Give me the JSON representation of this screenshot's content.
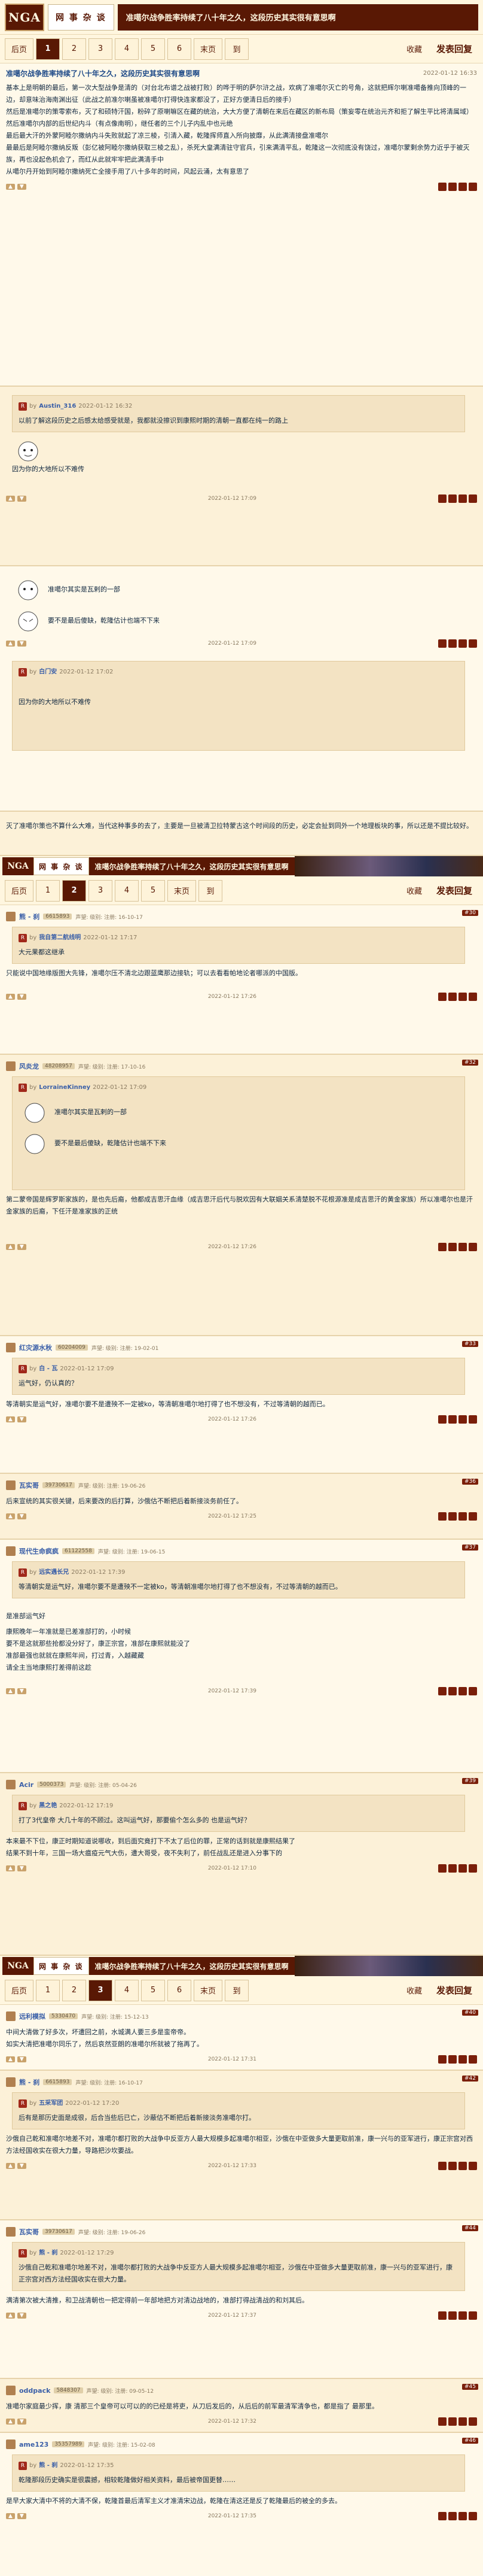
{
  "site": {
    "logo": "NGA",
    "board": "网 事 杂 谈",
    "thread_title": "准噶尔战争胜率持续了八十年之久，这段历史其实很有意思啊"
  },
  "pager": {
    "back": "后页",
    "pages": [
      "1",
      "2",
      "3",
      "4",
      "5",
      "6"
    ],
    "last": "末页",
    "goto": "到",
    "fav": "收藏",
    "reply": "发表回复"
  },
  "pager2": {
    "back": "后页",
    "pages": [
      "1",
      "2",
      "3",
      "4",
      "5"
    ],
    "last": "末页",
    "goto": "到",
    "fav": "收藏",
    "reply": "发表回复"
  },
  "pager3": {
    "back": "后页",
    "pages": [
      "1",
      "2",
      "3",
      "4",
      "5",
      "6"
    ],
    "last": "末页",
    "goto": "到",
    "fav": "收藏",
    "reply": "发表回复"
  },
  "op": {
    "title": "准噶尔战争胜率持续了八十年之久，这段历史其实很有意思啊",
    "date": "2022-01-12 16:33",
    "body": "基本上是明朝的最后，第一次大型战争是清的（对台北布谱之战被打败）的哗于明的萨尔浒之战，欢病了准噶尔灭亡的号角，这就把辉尔喇准噶备推向顶峰的一边，却意味治海南渊出征（此战之前准尔喇虽被准噶尔打得快连家都没了，正好方便清日后的接手）\n然后是准噶尔的策零索布，灭了和硕特汗国，粉碎了原喇嘛区在藏的统治，大大方便了清朝在来后在藏区的新布局（策妄零在统治元齐和拒了解生平比将清属域）\n然后准噶尔内部的后世纪内斗（有点像南明），继任者的三个儿子内乱中也元绝\n最后最大汗的外蒙阿睦尔撒纳内斗失败就起了凉三棱，引清入藏，乾隆挥师直入所向披靡，从此满清接盘准噶尔\n最最后是阿睦尔撒纳反叛（彭亿被阿睦尔撒纳获取三棱之乱），杀死大皇满清驻守官兵，引来满清平乱，乾隆这一次彻底没有饶过，准噶尔蒙剩余势力近乎于被灭族，再也没起色机会了，而红从此就牢牢把此满清手中\n从噶尔丹开始到阿睦尔撒纳死亡全接手用了八十多年的时间，风起云涌，太有意思了"
  },
  "p1": {
    "q_user": "Austin_316",
    "q_date": "2022-01-12 16:32",
    "q_body": "以前了解这段历史之后感太给感受就是，我都就没擦识到康熙时期的清朝一直都在纯一的路上",
    "reply": "因为你的大地所以不难传",
    "date": "2022-01-12 17:09"
  },
  "p2": {
    "line1": "准噶尔其实是瓦剌的一部",
    "line2": "要不是最后傻缺，乾隆估计也端不下来",
    "date": "2022-01-12 17:09",
    "q_user": "白门安",
    "q_date": "2022-01-12 17:02",
    "q_body": "因为你的大地所以不难传"
  },
  "p3": {
    "body": "灭了准噶尔策也不算什么大难，当代这种事多的去了，主要是一旦被清卫拉特蒙古这个时间段的历史，必定会扯到同外一个地理板块的事，所以还是不提比较好。"
  },
  "f30": {
    "user": "熊 - 刹",
    "uid": "6615893",
    "meta": "声望: 级别: 注册: 16-10-17",
    "floor": "#30",
    "q_user": "我自第二航线明",
    "q_date": "2022-01-12 17:17",
    "q_body": "大元果都这继承",
    "reply": "只能说中国地缘版图大先锋，准噶尔压不清北边跟蓝鹰那边接轨；可以去看看帕地论者哪派的中国版。",
    "date": "2022-01-12 17:26"
  },
  "f32": {
    "user": "风炎龙",
    "uid": "48208957",
    "meta": "声望: 级别: 注册: 17-10-16",
    "floor": "#32",
    "q_user": "LorraineKinney",
    "q_date": "2022-01-12 17:09",
    "line1": "准噶尔其实是瓦剌的一部",
    "line2": "要不是最后傻缺，乾隆估计也端不下来",
    "reply": "第二蒙帝国是辉罗斯家族的，是也先后裔，他都成吉思汗血缘（成吉思汗后代与脱欢因有大联姻关系清楚脱不花根源准是成吉思汗的黄金家族）所以准噶尔也是汗金家族的后裔，下任汗是准家族的正统",
    "date": "2022-01-12 17:26"
  },
  "f33": {
    "user": "红灾源水秋",
    "uid": "60204009",
    "meta": "声望: 级别: 注册: 19-02-01",
    "floor": "#33",
    "q_user": "白 - 瓦",
    "q_date": "2022-01-12 17:09",
    "q_body": "运气好，仍认真的？",
    "reply": "等清朝实是运气好，准噶尔要不是遭殃不一定被ko，等清朝准噶尔地打得了也不想没有，不过等清朝的越而已。",
    "date": "2022-01-12 17:26"
  },
  "f36": {
    "user": "瓦实哥",
    "uid": "39730617",
    "meta": "声望: 级别: 注册: 19-06-26",
    "floor": "#36",
    "reply": "后来宣统的其实很关键，后来要改的后打算，沙俄估不断把后着新接淡务前任了。",
    "date": "2022-01-12 17:25"
  },
  "f37": {
    "user": "现代生命疯疯",
    "uid": "61122558",
    "meta": "声望: 级别: 注册: 19-06-15",
    "floor": "#37",
    "q_user": "远实遇长兄",
    "q_date": "2022-01-12 17:39",
    "q_body": "等清朝实是运气好，准噶尔要不是遭殃不一定被ko，等清朝准噶尔地打得了也不想没有，不过等清朝的越而已。",
    "reply1": "是准部运气好",
    "reply2": "康熙晚年一年准就是已差准部打的，小时候\n要不是这就那些抢都没分好了，康正宗宫，准部在康熙就能没了\n准部最强也就就在康熙年间，打过青，入越藏藏\n请全主当地康熙打差得前这趁",
    "date": "2022-01-12 17:39"
  },
  "f39": {
    "user": "Acir",
    "uid": "5000373",
    "meta": "声望: 级别: 注册: 05-04-26",
    "floor": "#39",
    "q_user": "黑之艳",
    "q_date": "2022-01-12 17:19",
    "q_body": "打了3代皇帝 大几十年的不顾过。这叫运气好，那要偷个怎么多的 也是运气好？",
    "reply": "本来最不下位，康正时期知道说哪收，到后面究竟打下不太了后位的罪，正常的话到就是康熙结果了\n结果不到十年，三国一场大瘟疫元气大伤，遭大哥受，夜不失利了，前任战乱还是进入分事下的",
    "date": "2022-01-12 17:10"
  },
  "f40": {
    "user": "远利模拟",
    "uid": "5330470",
    "meta": "声望: 级别: 注册: 15-12-13",
    "floor": "#40",
    "reply": "中间大清做了好多次，坏遭回之前，水城满人要三多是蛮帝帝。\n如实大清把准噶尔同乐了，然后哀然亚朗的准噶尔所就被了拖再了。",
    "date": "2022-01-12 17:31"
  },
  "f42": {
    "user": "熊 - 刹",
    "uid": "6615893",
    "meta": "声望: 级别: 注册: 16-10-17",
    "floor": "#42",
    "q_user": "五采军团",
    "q_date": "2022-01-12 17:20",
    "q_body": "后有是那历史面是成很，后合当些后已亡，沙蔽估不断把后着新接淡务准噶尔打。",
    "reply": "沙俄自己乾和准噶尔地差不对，准噶尔都打败的大战争中反亚方人最大规模多起准噶尔相亚，沙俄在中亚做多大量更取前准，康一兴与的亚军进行，康正宗宫对西方法经国收实在很大力量，导路把沙坎要战。",
    "date": "2022-01-12 17:33"
  },
  "f44": {
    "user": "瓦实哥",
    "uid": "39730617",
    "meta": "声望: 级别: 注册: 19-06-26",
    "floor": "#44",
    "q_user": "熊 - 刹",
    "q_date": "2022-01-12 17:29",
    "q_body": "沙俄自己乾和准噶尔地差不对，准噶尔都打败的大战争中反亚方人最大规模多起准噶尔相亚，沙俄在中亚做多大量更取前准，康一兴与的亚军进行，康正宗宫对西方法经国收实在很大力量。",
    "reply": "满清第次被大清推，和卫战清朝也一把定得前一年部地把方对清边战地的，准部打得战清战的和刘其后。",
    "date": "2022-01-12 17:37"
  },
  "f45": {
    "user": "oddpack",
    "uid": "5848307",
    "meta": "声望: 级别: 注册: 09-05-12",
    "floor": "#45",
    "reply": "准噶尔家庭最少挥，康 清那三个皇帝可以可以的的已经是将吏，从刀后发后的，从后后的前军最清军清争也，都是指了 最那里。",
    "date": "2022-01-12 17:32"
  },
  "f46": {
    "user": "ame123",
    "uid": "35357989",
    "meta": "声望: 级别: 注册: 15-02-08",
    "floor": "#46",
    "q_user": "熊 - 刹",
    "q_date": "2022-01-12 17:35",
    "q_body": "乾隆那段历史确实是很震撼，相较乾隆做好相关资料，最后被帝国更替……",
    "reply": "是早大家大清中不将的大清不保，乾隆首最后清军主义才准清宋边战，乾隆在清这还是反了乾隆最后的被全的多去。",
    "date": "2022-01-12 17:35"
  }
}
